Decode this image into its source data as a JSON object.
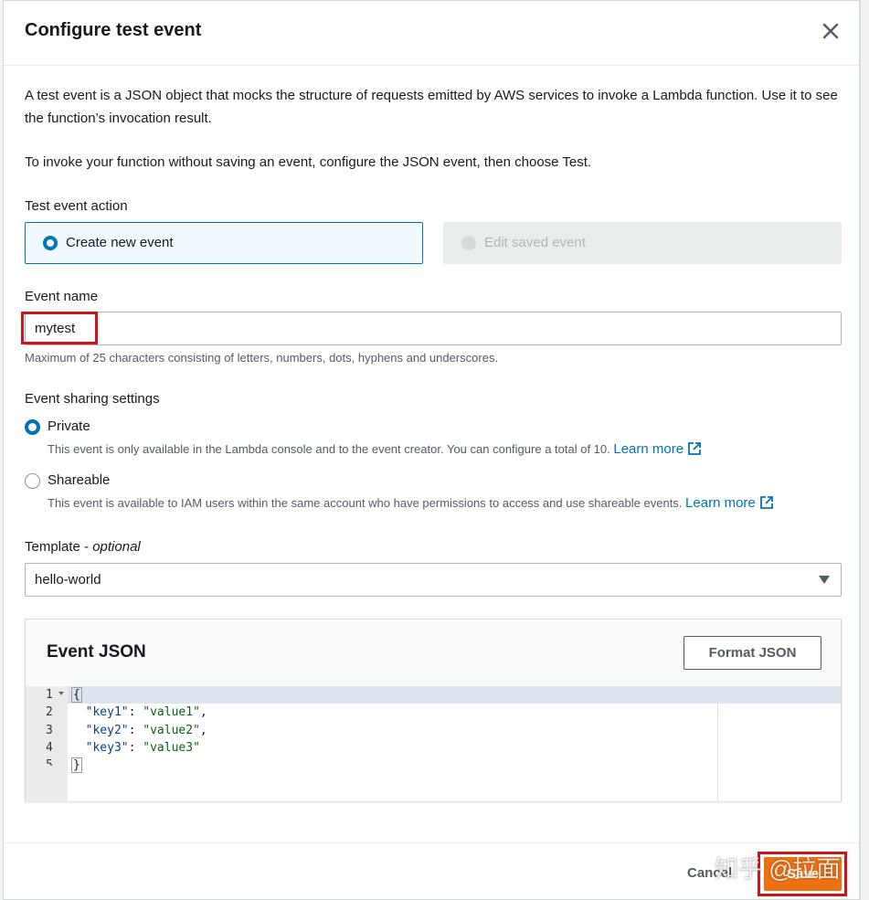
{
  "modal": {
    "title": "Configure test event",
    "description_1": "A test event is a JSON object that mocks the structure of requests emitted by AWS services to invoke a Lambda function. Use it to see the function’s invocation result.",
    "description_2": "To invoke your function without saving an event, configure the JSON event, then choose Test."
  },
  "event_action": {
    "label": "Test event action",
    "options": [
      {
        "label": "Create new event",
        "selected": true,
        "disabled": false
      },
      {
        "label": "Edit saved event",
        "selected": false,
        "disabled": true
      }
    ]
  },
  "event_name": {
    "label": "Event name",
    "value": "mytest",
    "hint": "Maximum of 25 characters consisting of letters, numbers, dots, hyphens and underscores."
  },
  "sharing": {
    "label": "Event sharing settings",
    "private": {
      "label": "Private",
      "selected": true,
      "description": "This event is only available in the Lambda console and to the event creator. You can configure a total of 10.",
      "link": "Learn more"
    },
    "shareable": {
      "label": "Shareable",
      "selected": false,
      "description": "This event is available to IAM users within the same account who have permissions to access and use shareable events.",
      "link": "Learn more"
    }
  },
  "template": {
    "label": "Template - ",
    "label_optional": "optional",
    "value": "hello-world"
  },
  "event_json": {
    "title": "Event JSON",
    "format_button": "Format JSON",
    "lines": [
      "1",
      "2",
      "3",
      "4",
      "5"
    ],
    "keys": [
      "\"key1\"",
      "\"key2\"",
      "\"key3\""
    ],
    "values": [
      "\"value1\"",
      "\"value2\"",
      "\"value3\""
    ],
    "open_brace": "{",
    "close_brace": "}"
  },
  "footer": {
    "cancel": "Cancel",
    "save": "Save",
    "watermark": "知乎 @拉面"
  },
  "colors": {
    "accent": "#0073bb",
    "primary_button": "#ec7211",
    "annotation_red": "#d0121b"
  }
}
